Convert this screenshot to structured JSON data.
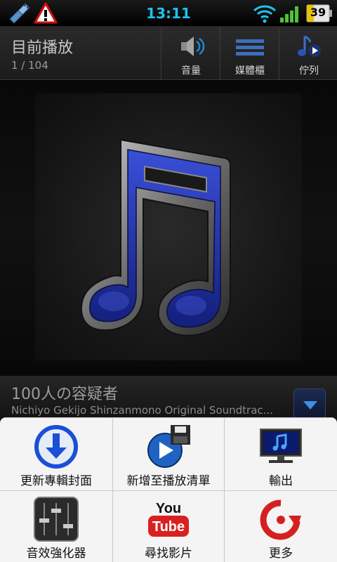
{
  "status_bar": {
    "time": "13:11",
    "battery_level": "39",
    "icons": [
      "usb-debug-icon",
      "warning-icon",
      "wifi-icon",
      "signal-icon",
      "battery-icon"
    ],
    "time_color": "#1ec2f0"
  },
  "header": {
    "title": "目前播放",
    "track_position": "1 / 104",
    "buttons": [
      {
        "label": "音量",
        "icon": "speaker-icon"
      },
      {
        "label": "媒體櫃",
        "icon": "library-icon"
      },
      {
        "label": "佇列",
        "icon": "queue-icon"
      }
    ]
  },
  "album_art": {
    "icon": "music-note-icon",
    "note_color": "#1d2b9c"
  },
  "track": {
    "title": "100人の容疑者",
    "subtitle": "Nichiyo Gekijo Shinzanmono Original Soundtrac...",
    "expand_icon": "chevron-down-icon"
  },
  "menu": {
    "items": [
      {
        "label": "更新專輯封面",
        "icon": "download-icon"
      },
      {
        "label": "新增至播放清單",
        "icon": "save-to-playlist-icon"
      },
      {
        "label": "輸出",
        "icon": "monitor-icon"
      },
      {
        "label": "音效強化器",
        "icon": "equalizer-icon"
      },
      {
        "label": "尋找影片",
        "icon": "youtube-icon"
      },
      {
        "label": "更多",
        "icon": "more-icon"
      }
    ]
  }
}
